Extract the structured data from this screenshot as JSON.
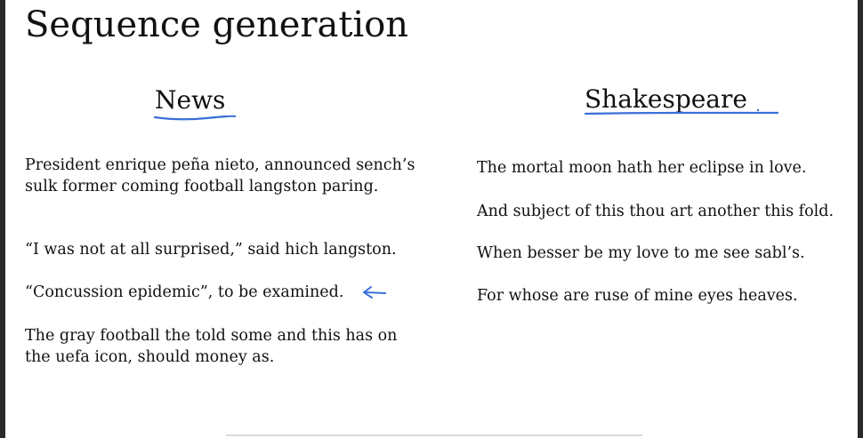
{
  "slide": {
    "title": "Sequence generation",
    "news": {
      "heading": "News",
      "paragraphs": [
        "President enrique peña nieto, announced sench’s sulk former coming football langston paring.",
        "“I was not at all surprised,” said hich langston.",
        "“Concussion epidemic”, to be examined.",
        "The gray football the told some and this has on the uefa icon, should money as."
      ]
    },
    "shakespeare": {
      "heading": "Shakespeare",
      "lines": [
        "The mortal moon hath her eclipse in love.",
        "And subject of this thou art another this fold.",
        "When besser be my love to me see sabl’s.",
        "For whose are ruse of mine eyes heaves."
      ]
    },
    "annotation_color": "#3a6fd8",
    "arrow_icon": "left-arrow-icon"
  }
}
